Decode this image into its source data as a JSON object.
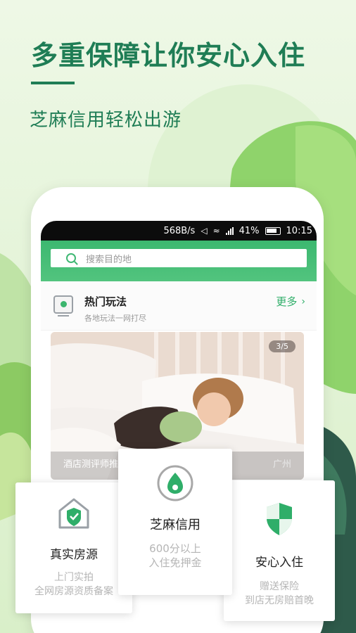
{
  "headline": "多重保障让你安心入住",
  "subheadline": "芝麻信用轻松出游",
  "status_bar": {
    "speed": "568B/s",
    "battery": "41%",
    "time": "10:15"
  },
  "search": {
    "placeholder": "搜索目的地"
  },
  "section": {
    "title": "热门玩法",
    "subtitle": "各地玩法一网打尽",
    "more_label": "更多"
  },
  "hero": {
    "pager": "3/5",
    "caption": "酒店测评师推荐｜睡在云朵里，…",
    "location": "广州"
  },
  "features": [
    {
      "icon": "house-check-icon",
      "title": "真实房源",
      "line1": "上门实拍",
      "line2": "全网房源资质备案"
    },
    {
      "icon": "sesame-credit-icon",
      "title": "芝麻信用",
      "line1": "600分以上",
      "line2": "入住免押金"
    },
    {
      "icon": "shield-icon",
      "title": "安心入住",
      "line1": "赠送保险",
      "line2": "到店无房赔首晚"
    }
  ],
  "colors": {
    "brand_green": "#1f7d55",
    "accent_green": "#3cb870",
    "background": "#e9f6df"
  }
}
